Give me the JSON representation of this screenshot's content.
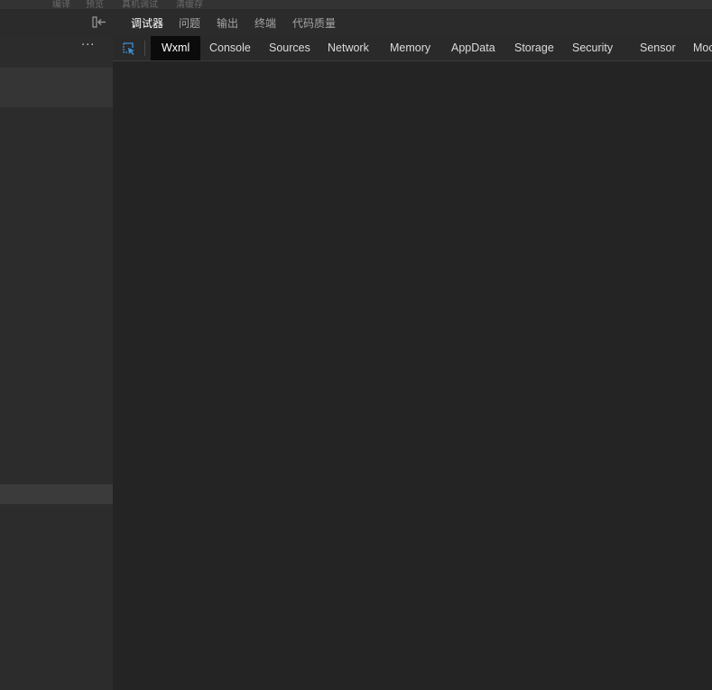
{
  "top_strip": {
    "fragments": [
      "编译",
      "预览",
      "真机调试",
      "清缓存"
    ]
  },
  "panel_tabs": [
    {
      "label": "调试器",
      "active": true
    },
    {
      "label": "问题",
      "active": false
    },
    {
      "label": "输出",
      "active": false
    },
    {
      "label": "终端",
      "active": false
    },
    {
      "label": "代码质量",
      "active": false
    }
  ],
  "left_panel": {
    "more_label": "···"
  },
  "devtools_tabs": [
    {
      "label": "Wxml",
      "active": true
    },
    {
      "label": "Console",
      "active": false
    },
    {
      "label": "Sources",
      "active": false
    },
    {
      "label": "Network",
      "active": false
    },
    {
      "label": "Memory",
      "active": false
    },
    {
      "label": "AppData",
      "active": false
    },
    {
      "label": "Storage",
      "active": false
    },
    {
      "label": "Security",
      "active": false
    },
    {
      "label": "Sensor",
      "active": false
    },
    {
      "label": "Mock",
      "active": false
    }
  ],
  "colors": {
    "inspect_icon": "#3d8fd6",
    "active_tab_bg": "#0b0b0b"
  }
}
